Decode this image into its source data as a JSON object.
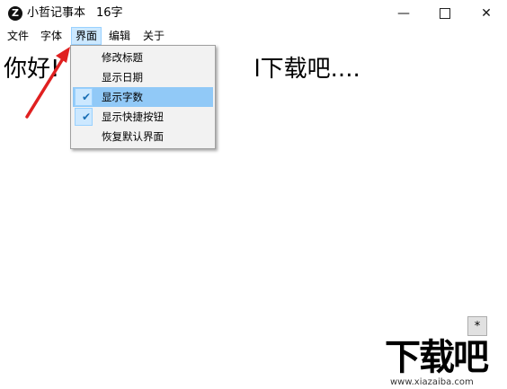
{
  "window": {
    "app_icon_letter": "Z",
    "title": "小哲记事本",
    "char_count": "16字",
    "minimize": "—",
    "close": "✕"
  },
  "menubar": {
    "items": [
      {
        "label": "文件"
      },
      {
        "label": "字体"
      },
      {
        "label": "界面"
      },
      {
        "label": "编辑"
      },
      {
        "label": "关于"
      }
    ]
  },
  "dropdown": {
    "items": [
      {
        "label": "修改标题",
        "checked": false
      },
      {
        "label": "显示日期",
        "checked": false
      },
      {
        "label": "显示字数",
        "checked": true
      },
      {
        "label": "显示快捷按钮",
        "checked": true
      },
      {
        "label": "恢复默认界面",
        "checked": false
      }
    ],
    "check_glyph": "✔"
  },
  "editor": {
    "visible_text_left": "你好!",
    "visible_text_right": "l下载吧...."
  },
  "shortcut_button": {
    "label": "*"
  },
  "watermark": {
    "logo_text": "下载吧",
    "url": "www.xiazaiba.com"
  },
  "colors": {
    "menu_highlight": "#cce8ff",
    "dropdown_hover": "#91c9f7",
    "arrow": "#e02020"
  }
}
